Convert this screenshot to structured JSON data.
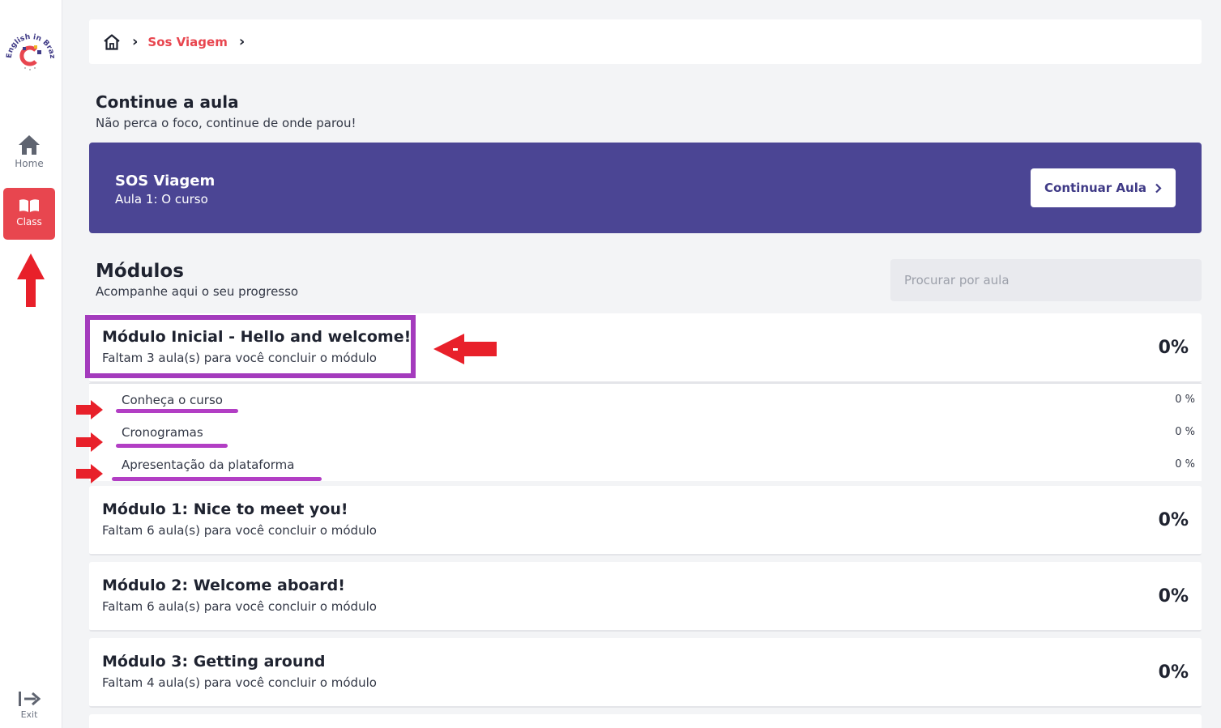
{
  "sidebar": {
    "logo_text": "English in Brazil",
    "home_label": "Home",
    "class_label": "Class",
    "exit_label": "Exit"
  },
  "breadcrumb": {
    "current": "Sos Viagem"
  },
  "continue_section": {
    "title": "Continue a aula",
    "subtitle": "Não perca o foco, continue de onde parou!",
    "card_title": "SOS Viagem",
    "card_subtitle": "Aula 1: O curso",
    "button_label": "Continuar Aula"
  },
  "modules_section": {
    "title": "Módulos",
    "subtitle": "Acompanhe aqui o seu progresso",
    "search_placeholder": "Procurar por aula"
  },
  "modules": [
    {
      "title": "Módulo Inicial - Hello and welcome!",
      "subtitle": "Faltam 3 aula(s) para você concluir o módulo",
      "progress": "0%",
      "lessons": [
        {
          "name": "Conheça o curso",
          "progress": "0 %"
        },
        {
          "name": "Cronogramas",
          "progress": "0 %"
        },
        {
          "name": "Apresentação da plataforma",
          "progress": "0 %"
        }
      ]
    },
    {
      "title": "Módulo 1: Nice to meet you!",
      "subtitle": "Faltam 6 aula(s) para você concluir o módulo",
      "progress": "0%"
    },
    {
      "title": "Módulo 2: Welcome aboard!",
      "subtitle": "Faltam 6 aula(s) para você concluir o módulo",
      "progress": "0%"
    },
    {
      "title": "Módulo 3: Getting around",
      "subtitle": "Faltam 4 aula(s) para você concluir o módulo",
      "progress": "0%"
    }
  ],
  "colors": {
    "accent_red": "#e8464f",
    "card_purple": "#4b4594",
    "annotation_purple": "#a43bbd",
    "annotation_arrow": "#e8202a"
  },
  "icons": [
    "home-icon",
    "book-icon",
    "exit-icon",
    "chevron-right-icon"
  ]
}
